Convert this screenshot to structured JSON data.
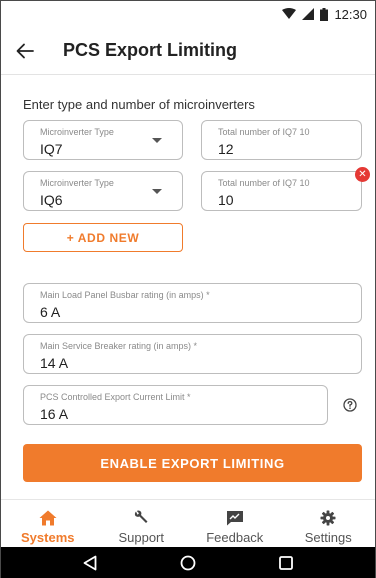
{
  "status_bar": {
    "time": "12:30",
    "icons": [
      "wifi-icon",
      "signal-icon",
      "battery-icon"
    ]
  },
  "app_bar": {
    "title": "PCS Export Limiting",
    "back_icon": "arrow-left-icon"
  },
  "section_label": "Enter type and number of microinverters",
  "microinverters": [
    {
      "type_label": "Microinverter Type",
      "type_value": "IQ7",
      "count_label": "Total number of IQ7 10",
      "count_value": "12",
      "removable": false
    },
    {
      "type_label": "Microinverter Type",
      "type_value": "IQ6",
      "count_label": "Total number of IQ7 10",
      "count_value": "10",
      "removable": true,
      "remove_icon_text": "✕"
    }
  ],
  "add_new_label": "+ ADD NEW",
  "busbar": {
    "label": "Main Load Panel Busbar rating (in amps) *",
    "value": "6 A"
  },
  "breaker": {
    "label": "Main Service Breaker rating (in amps) *",
    "value": "14 A"
  },
  "export_limit": {
    "label": "PCS Controlled Export Current Limit *",
    "value": "16 A",
    "help_icon": "help-circle-icon"
  },
  "primary_button": "ENABLE EXPORT LIMITING",
  "bottom_nav": [
    {
      "label": "Systems",
      "icon": "home-icon",
      "active": true
    },
    {
      "label": "Support",
      "icon": "wrench-icon",
      "active": false
    },
    {
      "label": "Feedback",
      "icon": "feedback-icon",
      "active": false
    },
    {
      "label": "Settings",
      "icon": "gear-icon",
      "active": false
    }
  ],
  "colors": {
    "accent": "#f07b2c",
    "error": "#e53935",
    "border": "#bdbdbd"
  }
}
